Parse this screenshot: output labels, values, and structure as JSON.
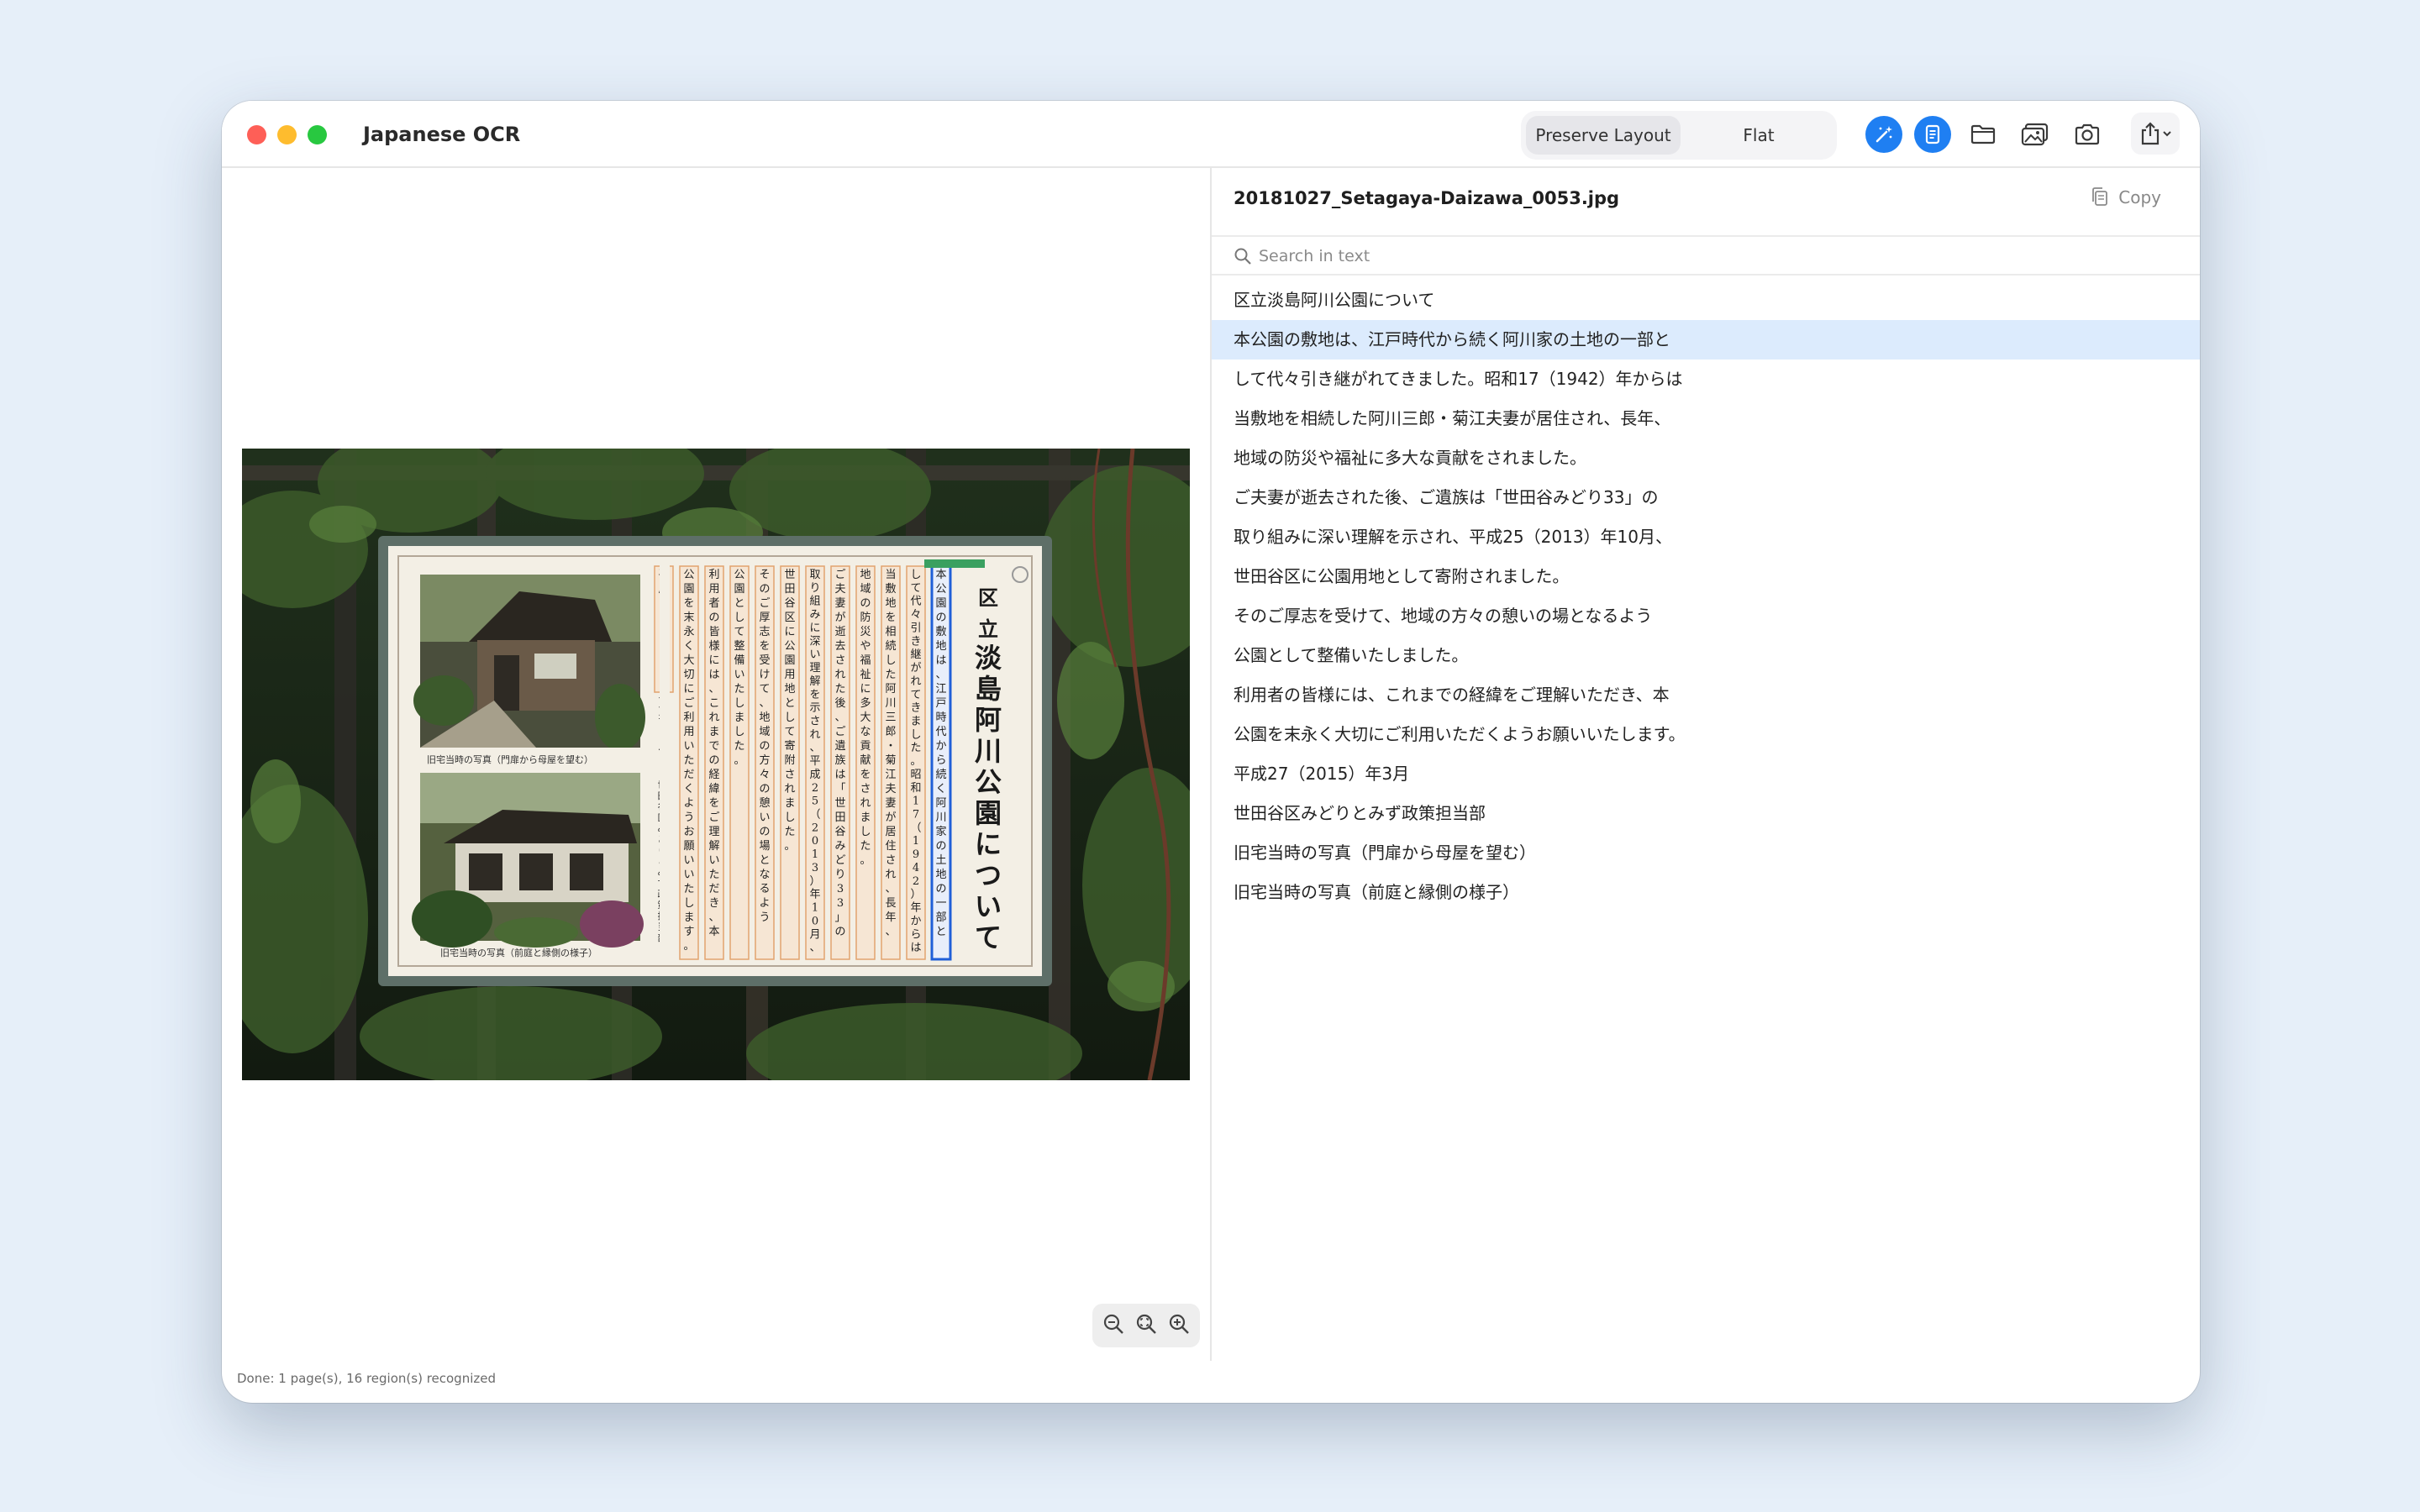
{
  "window": {
    "title": "Japanese OCR"
  },
  "toolbar": {
    "layout_modes": [
      "Preserve Layout",
      "Flat"
    ],
    "selected_mode": "Preserve Layout",
    "icons": [
      "magic-wand-icon",
      "document-text-icon",
      "folder-icon",
      "photo-icon",
      "camera-icon",
      "share-icon",
      "chevron-down-icon"
    ]
  },
  "file": {
    "name": "20181027_Setagaya-Daizawa_0053.jpg",
    "copy_label": "Copy"
  },
  "search": {
    "placeholder": "Search in text"
  },
  "ocr_lines": [
    "区立淡島阿川公園について",
    "本公園の敷地は、江戸時代から続く阿川家の土地の一部と",
    "して代々引き継がれてきました。昭和17（1942）年からは",
    "当敷地を相続した阿川三郎・菊江夫妻が居住され、長年、",
    "地域の防災や福祉に多大な貢献をされました。",
    "ご夫妻が逝去された後、ご遺族は「世田谷みどり33」の",
    "取り組みに深い理解を示され、平成25（2013）年10月、",
    "世田谷区に公園用地として寄附されました。",
    "そのご厚志を受けて、地域の方々の憩いの場となるよう",
    "公園として整備いたしました。",
    "利用者の皆様には、これまでの経緯をご理解いただき、本",
    "公園を末永く大切にご利用いただくようお願いいたします。",
    "平成27（2015）年3月",
    "世田谷区みどりとみず政策担当部",
    "旧宅当時の写真（門扉から母屋を望む）",
    "旧宅当時の写真（前庭と縁側の様子）"
  ],
  "selected_line_index": 1,
  "sign": {
    "title_chars": [
      "区",
      "立",
      "淡",
      "島",
      "阿",
      "川",
      "公",
      "園",
      "に",
      "つ",
      "い",
      "て"
    ],
    "caption_top": "旧宅当時の写真（門扉から母屋を望む）",
    "caption_bottom": "旧宅当時の写真（前庭と縁側の様子）",
    "date_vertical": "平成27年3月",
    "dept_vertical": "世田谷区みどりとみず政策担当部"
  },
  "zoom": {
    "icons": [
      "zoom-out-icon",
      "zoom-fit-icon",
      "zoom-in-icon"
    ]
  },
  "status": "Done: 1 page(s), 16 region(s) recognized",
  "colors": {
    "accent": "#1f7ff2",
    "selection": "#dcebfd",
    "background": "#e6eff9"
  }
}
